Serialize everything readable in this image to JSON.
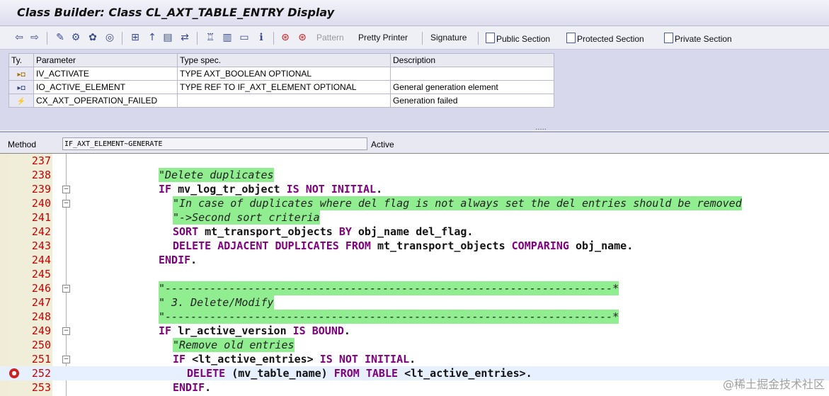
{
  "window": {
    "title": "Class Builder: Class CL_AXT_TABLE_ENTRY Display"
  },
  "toolbar": {
    "icons": [
      "back-arrow-icon",
      "forward-arrow-icon",
      "edit-pencil-icon",
      "display-change-icon",
      "activate-icon",
      "where-used-icon",
      "object-list-icon",
      "insert-icon",
      "check-icon",
      "navigate-icon",
      "hierarchy-icon",
      "print-icon",
      "layout-icon",
      "info-icon",
      "breakpoint-icon",
      "session-breakpoint-icon"
    ],
    "pattern": "Pattern",
    "pretty_printer": "Pretty Printer",
    "signature": "Signature",
    "public_section": "Public Section",
    "protected_section": "Protected Section",
    "private_section": "Private Section"
  },
  "params": {
    "headers": [
      "Ty.",
      "Parameter",
      "Type spec.",
      "Description"
    ],
    "rows": [
      {
        "icon": "importing-icon",
        "name": "IV_ACTIVATE",
        "type": "TYPE AXT_BOOLEAN OPTIONAL",
        "desc": ""
      },
      {
        "icon": "importing-icon",
        "name": "IO_ACTIVE_ELEMENT",
        "type": "TYPE REF TO IF_AXT_ELEMENT OPTIONAL",
        "desc": "General generation element"
      },
      {
        "icon": "exception-icon",
        "name": "CX_AXT_OPERATION_FAILED",
        "type": "",
        "desc": "Generation failed"
      }
    ],
    "resize_handle": "....."
  },
  "method": {
    "label": "Method",
    "value": "IF_AXT_ELEMENT~GENERATE",
    "status": "Active"
  },
  "code": [
    {
      "n": "237",
      "text": ""
    },
    {
      "n": "238",
      "comment": "\"Delete duplicates"
    },
    {
      "n": "239",
      "text": "IF mv_log_tr_object IS NOT INITIAL."
    },
    {
      "n": "240",
      "comment": "\"In case of duplicates where del flag is not always set the del entries should be removed"
    },
    {
      "n": "241",
      "comment": "\"->Second sort criteria"
    },
    {
      "n": "242",
      "text": "SORT mt_transport_objects BY obj_name del_flag."
    },
    {
      "n": "243",
      "text": "DELETE ADJACENT DUPLICATES FROM mt_transport_objects COMPARING obj_name."
    },
    {
      "n": "244",
      "text": "ENDIF."
    },
    {
      "n": "245",
      "text": ""
    },
    {
      "n": "246",
      "comment": "\"----------------------------------------------------------------------*"
    },
    {
      "n": "247",
      "comment": "\" 3. Delete/Modify"
    },
    {
      "n": "248",
      "comment": "\"----------------------------------------------------------------------*"
    },
    {
      "n": "249",
      "text": "IF lr_active_version IS BOUND."
    },
    {
      "n": "250",
      "comment": "\"Remove old entries"
    },
    {
      "n": "251",
      "text": "IF <lt_active_entries> IS NOT INITIAL."
    },
    {
      "n": "252",
      "text": "DELETE (mv_table_name) FROM TABLE <lt_active_entries>."
    },
    {
      "n": "253",
      "text": "ENDIF."
    }
  ],
  "watermark": "@稀土掘金技术社区"
}
